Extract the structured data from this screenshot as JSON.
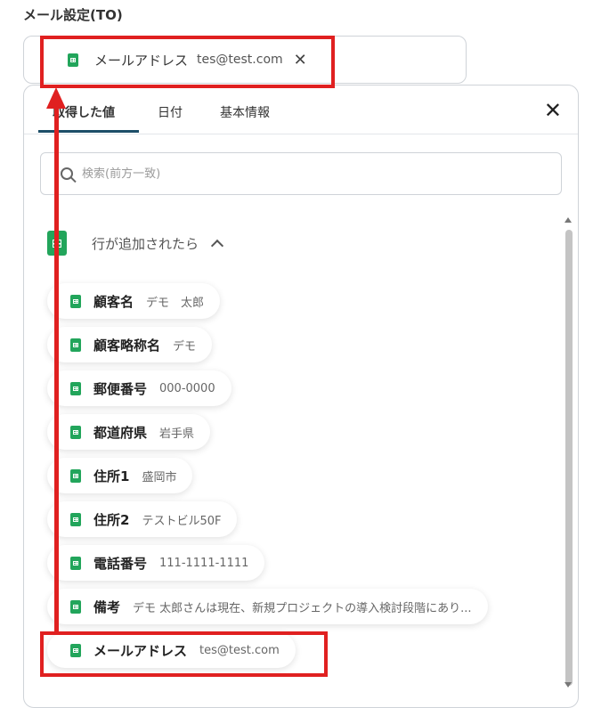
{
  "field": {
    "label": "メール設定(TO)",
    "selected_chip": {
      "name": "メールアドレス",
      "value": "tes@test.com",
      "close": "✕"
    }
  },
  "panel": {
    "tabs": [
      {
        "label": "取得した値",
        "active": true
      },
      {
        "label": "日付",
        "active": false
      },
      {
        "label": "基本情報",
        "active": false
      }
    ],
    "close": "✕",
    "search": {
      "placeholder": "検索(前方一致)"
    },
    "group": {
      "title": "行が追加されたら"
    },
    "items": [
      {
        "name": "顧客名",
        "value": "デモ　太郎"
      },
      {
        "name": "顧客略称名",
        "value": "デモ"
      },
      {
        "name": "郵便番号",
        "value": "000-0000"
      },
      {
        "name": "都道府県",
        "value": "岩手県"
      },
      {
        "name": "住所1",
        "value": "盛岡市"
      },
      {
        "name": "住所2",
        "value": "テストビル50F"
      },
      {
        "name": "電話番号",
        "value": "111-1111-1111"
      },
      {
        "name": "備考",
        "value": "デモ 太郎さんは現在、新規プロジェクトの導入検討段階にあり..."
      },
      {
        "name": "メールアドレス",
        "value": "tes@test.com"
      }
    ]
  },
  "colors": {
    "accent": "#1d4e68",
    "sheet_green": "#22a55b",
    "highlight_red": "#e02020"
  }
}
